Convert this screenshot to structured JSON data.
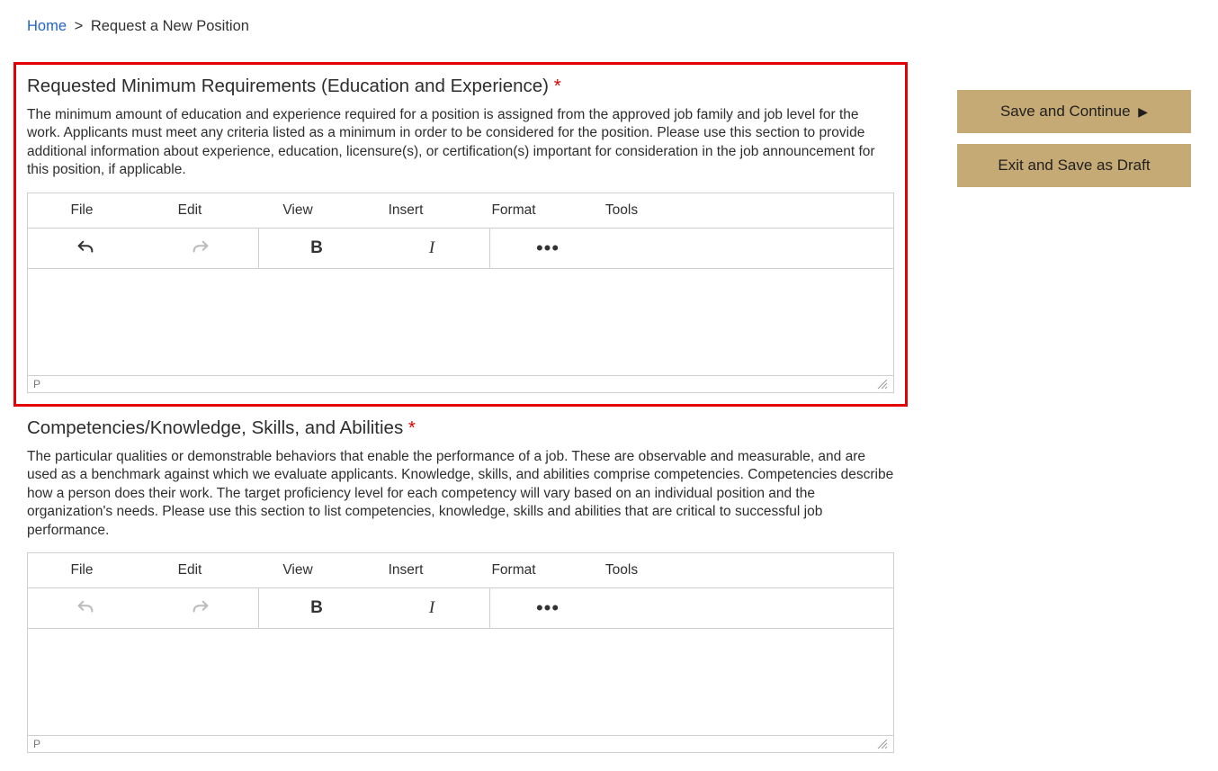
{
  "breadcrumb": {
    "home": "Home",
    "separator": ">",
    "current": "Request a New Position"
  },
  "sections": {
    "minReq": {
      "title": "Requested Minimum Requirements (Education and Experience)",
      "desc": "The minimum amount of education and experience required for a position is assigned from the approved job family and job level for the work. Applicants must meet any criteria listed as a minimum in order to be considered for the position. Please use this section to provide additional information about experience, education, licensure(s), or certification(s) important for consideration in the job announcement for this position, if applicable.",
      "statusPath": "P"
    },
    "competencies": {
      "title": "Competencies/Knowledge, Skills, and Abilities",
      "desc": "The particular qualities or demonstrable behaviors that enable the performance of a job. These are observable and measurable, and are used as a benchmark against which we evaluate applicants. Knowledge, skills, and abilities comprise competencies. Competencies describe how a person does their work. The target proficiency level for each competency will vary based on an individual position and the organization's needs. Please use this section to list competencies, knowledge, skills and abilities that are critical to successful job performance.",
      "statusPath": "P"
    }
  },
  "required_marker": "*",
  "editor": {
    "menus": {
      "file": "File",
      "edit": "Edit",
      "view": "View",
      "insert": "Insert",
      "format": "Format",
      "tools": "Tools"
    },
    "toolbar": {
      "bold": "B",
      "italic": "I",
      "more": "•••"
    }
  },
  "buttons": {
    "saveContinue": "Save and Continue",
    "saveContinueArrow": "▶",
    "exitDraft": "Exit and Save as Draft"
  }
}
